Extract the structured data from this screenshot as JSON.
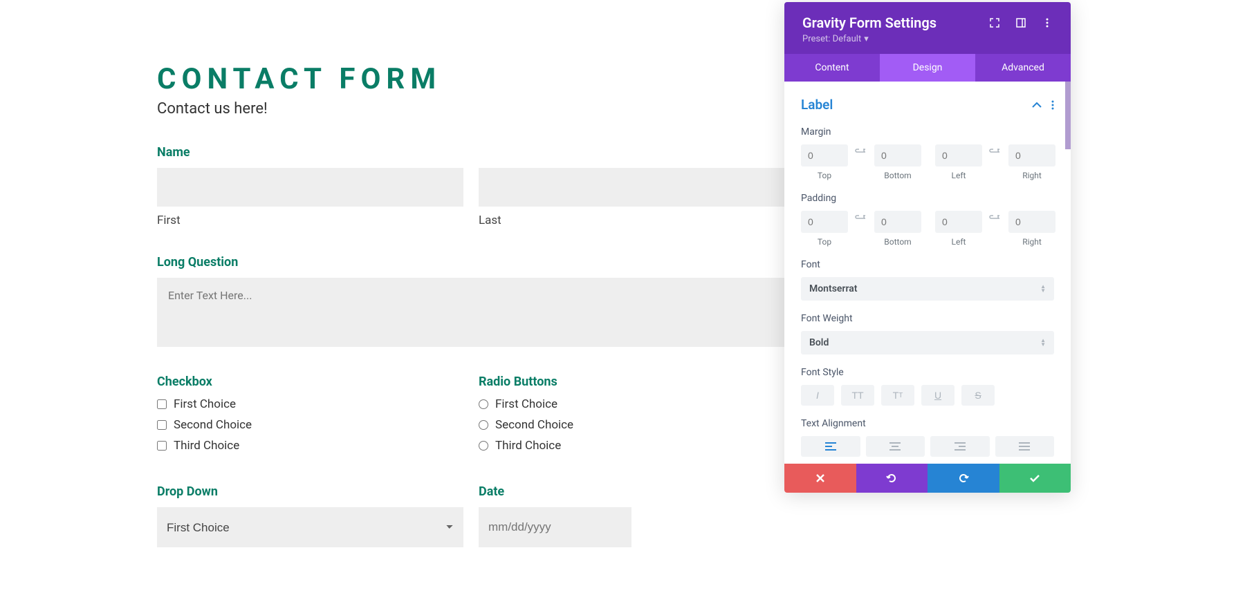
{
  "form": {
    "title": "CONTACT FORM",
    "subtitle": "Contact us here!",
    "name_label": "Name",
    "first_sublabel": "First",
    "last_sublabel": "Last",
    "long_question_label": "Long Question",
    "textarea_placeholder": "Enter Text Here...",
    "checkbox_label": "Checkbox",
    "radio_label": "Radio Buttons",
    "choices": [
      "First Choice",
      "Second Choice",
      "Third Choice"
    ],
    "dropdown_label": "Drop Down",
    "dropdown_value": "First Choice",
    "date_label": "Date",
    "date_placeholder": "mm/dd/yyyy"
  },
  "panel": {
    "title": "Gravity Form Settings",
    "preset_label": "Preset: Default",
    "tabs": {
      "content": "Content",
      "design": "Design",
      "advanced": "Advanced"
    },
    "section": "Label",
    "margin_label": "Margin",
    "padding_label": "Padding",
    "spacing_sublabels": {
      "top": "Top",
      "bottom": "Bottom",
      "left": "Left",
      "right": "Right"
    },
    "spacing_placeholder": "0",
    "font_label": "Font",
    "font_value": "Montserrat",
    "weight_label": "Font Weight",
    "weight_value": "Bold",
    "style_label": "Font Style",
    "align_label": "Text Alignment"
  }
}
